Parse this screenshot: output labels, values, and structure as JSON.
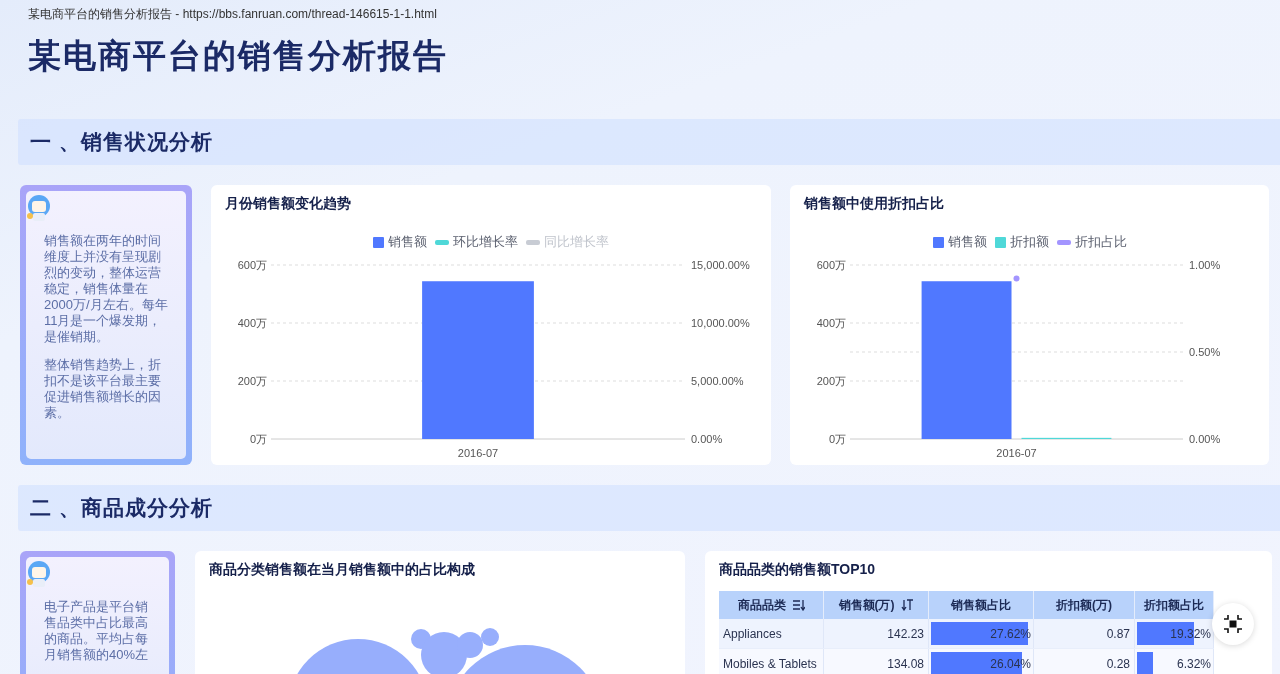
{
  "browser_tab_title": "某电商平台的销售分析报告 - https://bbs.fanruan.com/thread-146615-1-1.html",
  "title": "某电商平台的销售分析报告",
  "sections": [
    {
      "heading": "一 、销售状况分析",
      "note": {
        "paragraphs": [
          "销售额在两年的时间维度上并没有呈现剧烈的变动，整体运营稳定，销售体量在2000万/月左右。每年11月是一个爆发期，是催销期。",
          "整体销售趋势上，折扣不是该平台最主要促进销售额增长的因素。"
        ]
      },
      "panels": [
        {
          "kind": "chart",
          "title": "月份销售额变化趋势",
          "legend": [
            {
              "disabled": false
            },
            {
              "disabled": false
            },
            {
              "disabled": true
            }
          ],
          "right_axis": {
            "tick_labels": [
              "15,000.00%",
              "10,000.00%",
              "5,000.00%",
              "0.00%"
            ]
          },
          "chart_data": {
            "type": "bar",
            "categories": [
              "2016-07"
            ],
            "ylim": [
              0,
              600
            ],
            "yticks": [
              {
                "value": 0,
                "label": "0万"
              },
              {
                "value": 200,
                "label": "200万"
              },
              {
                "value": 400,
                "label": "400万"
              },
              {
                "value": 600,
                "label": "600万"
              }
            ],
            "series": [
              {
                "name": "销售额",
                "type": "bar",
                "color": "#5078ff",
                "values": [
                  544
                ]
              },
              {
                "name": "环比增长率",
                "type": "line",
                "color": "#4fd8d8",
                "values": [
                  null
                ]
              },
              {
                "name": "同比增长率",
                "type": "line",
                "values": [
                  null
                ]
              }
            ]
          }
        },
        {
          "kind": "chart",
          "title": "销售额中使用折扣占比",
          "legend": [
            {
              "disabled": false
            },
            {
              "disabled": false
            },
            {
              "disabled": false
            }
          ],
          "right_axis": {
            "tick_labels": [
              "1.00%",
              "0.50%",
              "0.00%"
            ],
            "points": [
              {
                "level": 0.94
              }
            ]
          },
          "chart_data": {
            "type": "bar",
            "categories": [
              "2016-07"
            ],
            "ylim": [
              0,
              600
            ],
            "yticks": [
              {
                "value": 0,
                "label": "0万"
              },
              {
                "value": 200,
                "label": "200万"
              },
              {
                "value": 400,
                "label": "400万"
              },
              {
                "value": 600,
                "label": "600万"
              }
            ],
            "series": [
              {
                "name": "销售额",
                "type": "bar",
                "color": "#5078ff",
                "values": [
                  544
                ]
              },
              {
                "name": "折扣额",
                "type": "bar",
                "color": "#4fd8d8",
                "values": [
                  4
                ]
              },
              {
                "name": "折扣占比",
                "type": "line",
                "color": "#a395ff",
                "values": [
                  null
                ]
              }
            ]
          }
        }
      ]
    },
    {
      "heading": "二 、商品成分分析",
      "note": {
        "paragraphs": [
          "电子产品是平台销售品类中占比最高的商品。平均占每月销售额的40%左"
        ]
      },
      "panels": [
        {
          "kind": "bubbles",
          "title": "商品分类销售额在当月销售额中的占比构成"
        },
        {
          "kind": "table",
          "title": "商品品类的销售额TOP10",
          "columns": [
            {
              "label": "商品品类",
              "kind": "text",
              "sortable": true,
              "filtered": false
            },
            {
              "label": "销售额(万)",
              "kind": "number",
              "sortable": true,
              "filtered": true
            },
            {
              "label": "销售额占比",
              "kind": "bar",
              "sortable": false,
              "filtered": false
            },
            {
              "label": "折扣额(万)",
              "kind": "number",
              "sortable": false,
              "filtered": false
            },
            {
              "label": "折扣额占比",
              "kind": "bar",
              "sortable": false,
              "filtered": false
            }
          ],
          "rows": [
            {
              "cells": [
                {
                  "text": "Appliances"
                },
                {
                  "text": "142.23"
                },
                {
                  "text": "27.62%",
                  "level": 0.97
                },
                {
                  "text": "0.87"
                },
                {
                  "text": "19.32%",
                  "level": 0.78
                }
              ]
            },
            {
              "cells": [
                {
                  "text": "Mobiles & Tablets"
                },
                {
                  "text": "134.08"
                },
                {
                  "text": "26.04%",
                  "level": 0.91
                },
                {
                  "text": "0.28"
                },
                {
                  "text": "6.32%",
                  "level": 0.26
                }
              ]
            }
          ]
        }
      ]
    }
  ]
}
